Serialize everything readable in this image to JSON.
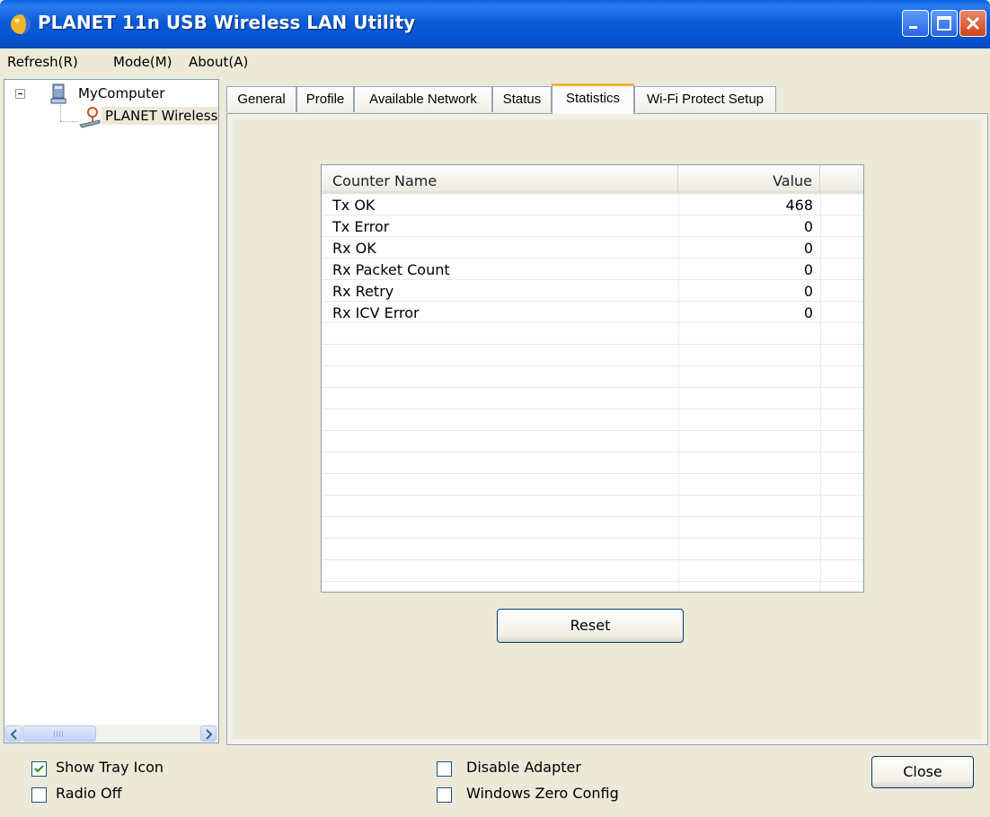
{
  "window": {
    "title": "PLANET 11n USB Wireless LAN Utility"
  },
  "menu": [
    "Refresh(R)",
    "Mode(M)",
    "About(A)"
  ],
  "tree": {
    "root": "MyComputer",
    "child": "PLANET Wireless"
  },
  "tabs": [
    "General",
    "Profile",
    "Available Network",
    "Status",
    "Statistics",
    "Wi-Fi Protect Setup"
  ],
  "active_tab": "Statistics",
  "statistics": {
    "columns": [
      "Counter Name",
      "Value"
    ],
    "rows": [
      {
        "name": "Tx OK",
        "value": "468"
      },
      {
        "name": "Tx Error",
        "value": "0"
      },
      {
        "name": "Rx OK",
        "value": "0"
      },
      {
        "name": "Rx Packet Count",
        "value": "0"
      },
      {
        "name": "Rx Retry",
        "value": "0"
      },
      {
        "name": "Rx ICV Error",
        "value": "0"
      }
    ],
    "reset_label": "Reset"
  },
  "options": {
    "show_tray_icon": {
      "label": "Show Tray Icon",
      "checked": true
    },
    "radio_off": {
      "label": "Radio Off",
      "checked": false
    },
    "disable_adapter": {
      "label": "Disable Adapter",
      "checked": false
    },
    "windows_zero_config": {
      "label": "Windows Zero Config",
      "checked": false
    }
  },
  "close_label": "Close"
}
